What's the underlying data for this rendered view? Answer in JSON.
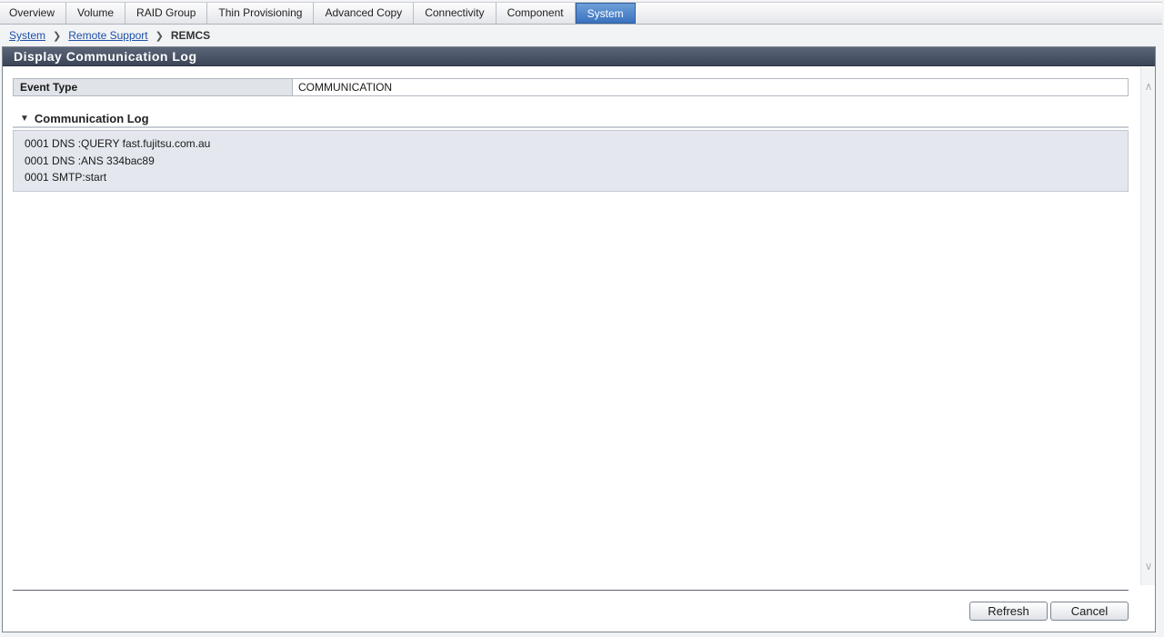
{
  "tabs": [
    {
      "label": "Overview"
    },
    {
      "label": "Volume"
    },
    {
      "label": "RAID Group"
    },
    {
      "label": "Thin Provisioning"
    },
    {
      "label": "Advanced Copy"
    },
    {
      "label": "Connectivity"
    },
    {
      "label": "Component"
    },
    {
      "label": "System",
      "active": true
    }
  ],
  "breadcrumb": {
    "items": [
      "System",
      "Remote Support"
    ],
    "current": "REMCS"
  },
  "panel": {
    "title": "Display Communication Log",
    "event_type": {
      "label": "Event Type",
      "value": "COMMUNICATION"
    },
    "section_title": "Communication Log",
    "log_lines": [
      "0001 DNS :QUERY fast.fujitsu.com.au",
      "0001 DNS :ANS 334bac89",
      "0001 SMTP:start"
    ]
  },
  "buttons": {
    "refresh": "Refresh",
    "cancel": "Cancel"
  },
  "icons": {
    "breadcrumb_separator": "chevron-right-icon",
    "section_toggle": "triangle-down-icon",
    "scroll_up": "chevron-up-icon",
    "scroll_down": "chevron-down-icon"
  },
  "colors": {
    "active_tab": "#3a72bf",
    "title_bar": "#3b4557",
    "link": "#1f4fa8"
  }
}
